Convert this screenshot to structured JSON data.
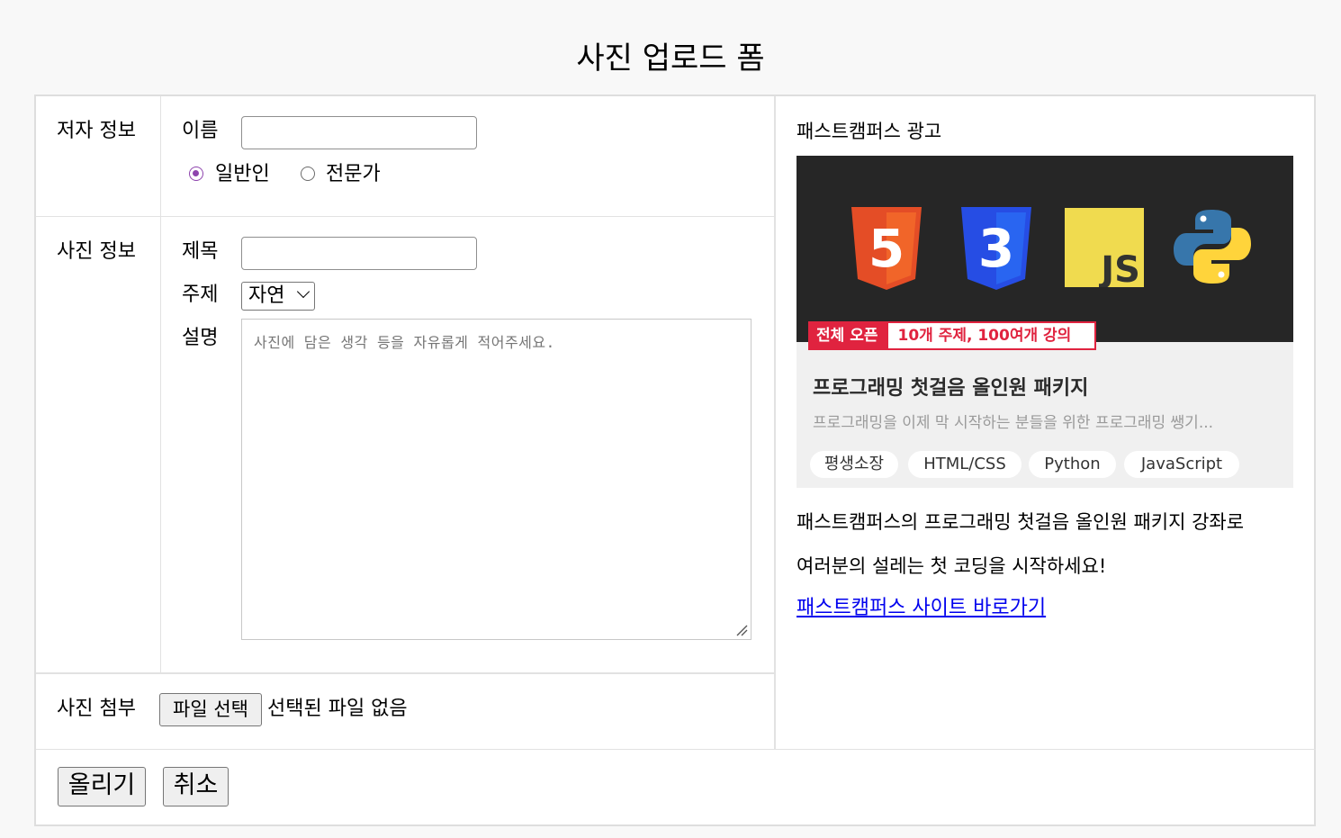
{
  "page": {
    "title": "사진 업로드 폼"
  },
  "author": {
    "section_label": "저자 정보",
    "name_label": "이름",
    "name_value": "",
    "types": [
      {
        "label": "일반인",
        "checked": true
      },
      {
        "label": "전문가",
        "checked": false
      }
    ]
  },
  "photo": {
    "section_label": "사진 정보",
    "title_label": "제목",
    "title_value": "",
    "subject_label": "주제",
    "subject_selected": "자연",
    "desc_label": "설명",
    "desc_placeholder": "사진에 담은 생각 등을 자유롭게 적어주세요."
  },
  "attach": {
    "section_label": "사진 첨부",
    "button_label": "파일 선택",
    "status": "선택된 파일 없음"
  },
  "actions": {
    "submit_label": "올리기",
    "cancel_label": "취소"
  },
  "ad": {
    "heading": "패스트캠퍼스 광고",
    "image": {
      "icons": [
        "html5-icon",
        "css3-icon",
        "javascript-icon",
        "python-icon"
      ],
      "html5_glyph": "5",
      "css3_glyph": "3",
      "js_glyph": "JS",
      "tag_primary": "전체 오픈",
      "tag_secondary": "10개 주제, 100여개 강의",
      "headline": "프로그래밍 첫걸음 올인원 패키지",
      "subline": "프로그래밍을 이제 막 시작하는 분들을 위한 프로그래밍 쌩기...",
      "chips": [
        "평생소장",
        "HTML/CSS",
        "Python",
        "JavaScript"
      ]
    },
    "text_line1": "패스트캠퍼스의 프로그래밍 첫걸음 올인원 패키지 강좌로",
    "text_line2": "여러분의 설레는 첫 코딩을 시작하세요!",
    "link_label": "패스트캠퍼스 사이트 바로가기"
  },
  "colors": {
    "radio_accent": "#8e44ad",
    "link": "#0000ee",
    "ad_dark": "#262626",
    "ad_red": "#e0233f",
    "html5": "#e44d26",
    "css3": "#264de4",
    "javascript": "#f0db4f",
    "python_blue": "#3776ab",
    "python_yellow": "#ffd43b"
  }
}
